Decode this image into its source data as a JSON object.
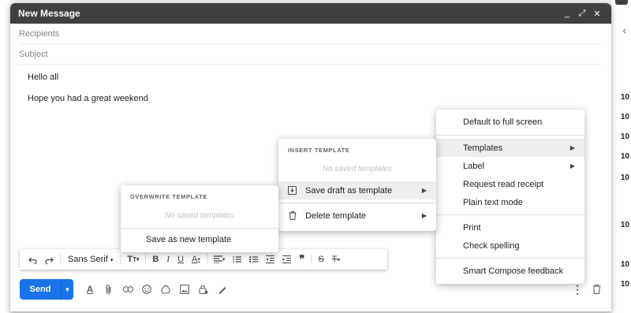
{
  "background": {
    "right_numbers": [
      "10",
      "10",
      "10",
      "10",
      "10",
      "10",
      "10",
      "10"
    ]
  },
  "compose": {
    "title": "New Message",
    "title_buttons": {
      "minimize": "_",
      "expand": "⤢",
      "close": "✕"
    },
    "recipients_placeholder": "Recipients",
    "subject_placeholder": "Subject",
    "body_line1": "Hello all",
    "body_line2": "Hope you had a great weekend"
  },
  "toolbar": {
    "font": "Sans Serif",
    "buttons": [
      "undo",
      "redo",
      "font-size",
      "bold",
      "italic",
      "underline",
      "text-color",
      "align",
      "numbered-list",
      "bulleted-list",
      "indent-less",
      "indent-more",
      "quote",
      "strikethrough",
      "remove-formatting"
    ]
  },
  "bottom": {
    "send_label": "Send"
  },
  "more_menu": {
    "items": {
      "default_full_screen": "Default to full screen",
      "templates": "Templates",
      "label": "Label",
      "read_receipt": "Request read receipt",
      "plain_text": "Plain text mode",
      "print": "Print",
      "check_spelling": "Check spelling",
      "smart_compose": "Smart Compose feedback"
    }
  },
  "templates_menu": {
    "header": "INSERT TEMPLATE",
    "empty": "No saved templates",
    "save_draft": "Save draft as template",
    "delete": "Delete template"
  },
  "overwrite_menu": {
    "header": "OVERWRITE TEMPLATE",
    "empty": "No saved templates",
    "save_new": "Save as new template"
  }
}
